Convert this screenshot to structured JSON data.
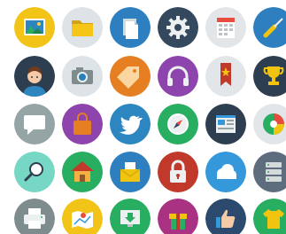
{
  "grid": {
    "rows": [
      [
        {
          "name": "picture-icon",
          "bg": "#f2c418"
        },
        {
          "name": "folder-icon",
          "bg": "#dde3e6"
        },
        {
          "name": "documents-icon",
          "bg": "#2e7fbf"
        },
        {
          "name": "gear-icon",
          "bg": "#34495e"
        },
        {
          "name": "calendar-icon",
          "bg": "#e2e6e9"
        },
        {
          "name": "screwdriver-icon",
          "bg": "#2e7fbf"
        }
      ],
      [
        {
          "name": "user-avatar-icon",
          "bg": "#2c3e50"
        },
        {
          "name": "camera-icon",
          "bg": "#dde3e6"
        },
        {
          "name": "price-tag-icon",
          "bg": "#e67e22"
        },
        {
          "name": "headphones-icon",
          "bg": "#8e44ad"
        },
        {
          "name": "bookmark-star-icon",
          "bg": "#e2e6e9"
        },
        {
          "name": "trophy-icon",
          "bg": "#2c3e50"
        }
      ],
      [
        {
          "name": "chat-bubble-icon",
          "bg": "#95a5a6"
        },
        {
          "name": "shopping-bag-icon",
          "bg": "#8e44ad"
        },
        {
          "name": "twitter-bird-icon",
          "bg": "#2e86c1"
        },
        {
          "name": "compass-icon",
          "bg": "#27ae60"
        },
        {
          "name": "browser-layout-icon",
          "bg": "#2c3e50"
        },
        {
          "name": "pie-chart-icon",
          "bg": "#e2e6e9"
        }
      ],
      [
        {
          "name": "search-icon",
          "bg": "#76d7c4"
        },
        {
          "name": "home-icon",
          "bg": "#27ae60"
        },
        {
          "name": "mail-envelope-icon",
          "bg": "#2e7fbf"
        },
        {
          "name": "padlock-icon",
          "bg": "#c0392b"
        },
        {
          "name": "cloud-icon",
          "bg": "#3498db"
        },
        {
          "name": "server-stack-icon",
          "bg": "#5d6d7e"
        }
      ],
      [
        {
          "name": "printer-icon",
          "bg": "#7f8c8d"
        },
        {
          "name": "map-location-icon",
          "bg": "#f2c418"
        },
        {
          "name": "download-icon",
          "bg": "#27ae60"
        },
        {
          "name": "gift-icon",
          "bg": "#a93283"
        },
        {
          "name": "thumbs-up-icon",
          "bg": "#2c4a6e"
        },
        {
          "name": "tshirt-icon",
          "bg": "#27ae60"
        }
      ]
    ]
  }
}
